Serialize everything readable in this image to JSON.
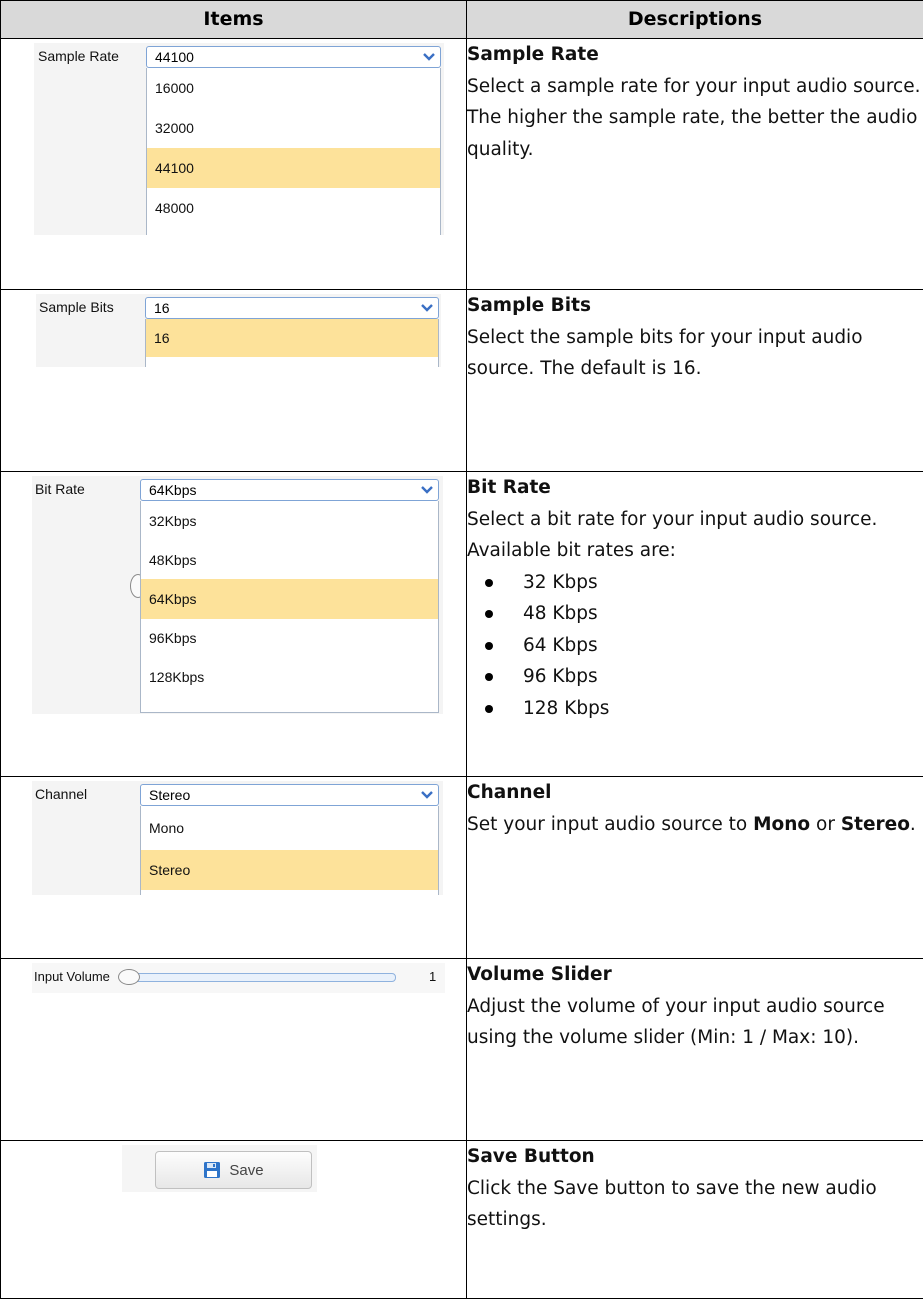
{
  "table": {
    "headers": [
      "Items",
      "Descriptions"
    ]
  },
  "sample_rate": {
    "label": "Sample Rate",
    "selected": "44100",
    "options": [
      "16000",
      "32000",
      "44100",
      "48000"
    ],
    "title": "Sample Rate",
    "description": "Select a sample rate for your input audio source. The higher the sample rate, the better the audio quality."
  },
  "sample_bits": {
    "label": "Sample Bits",
    "selected": "16",
    "options": [
      "16"
    ],
    "title": "Sample Bits",
    "description": "Select the sample bits for your input audio source. The default is 16."
  },
  "bit_rate": {
    "label": "Bit Rate",
    "selected": "64Kbps",
    "options": [
      "32Kbps",
      "48Kbps",
      "64Kbps",
      "96Kbps",
      "128Kbps"
    ],
    "title": "Bit Rate",
    "description": "Select a bit rate for your input audio source. Available bit rates are:",
    "bullets": [
      "32 Kbps",
      "48 Kbps",
      "64 Kbps",
      "96 Kbps",
      "128 Kbps"
    ]
  },
  "channel": {
    "label": "Channel",
    "selected": "Stereo",
    "options": [
      "Mono",
      "Stereo"
    ],
    "title": "Channel",
    "desc_prefix": "Set your input audio source to ",
    "mono": "Mono",
    "desc_or": " or ",
    "stereo": "Stereo",
    "desc_suffix": "."
  },
  "volume": {
    "label": "Input Volume",
    "value": "1",
    "level_fraction": 0.0,
    "title": "Volume Slider",
    "description": "Adjust the volume of your input audio source using the volume slider (Min: 1 / Max: 10)."
  },
  "save": {
    "button_label": "Save",
    "icon": "floppy-disk-icon",
    "title": "Save Button",
    "description": "Click the Save button to save the new audio settings."
  },
  "colors": {
    "header_bg": "#d9d9d9",
    "selected_option": "#fde29a",
    "select_border": "#7fa4d6",
    "arrow": "#3a6fc4"
  }
}
